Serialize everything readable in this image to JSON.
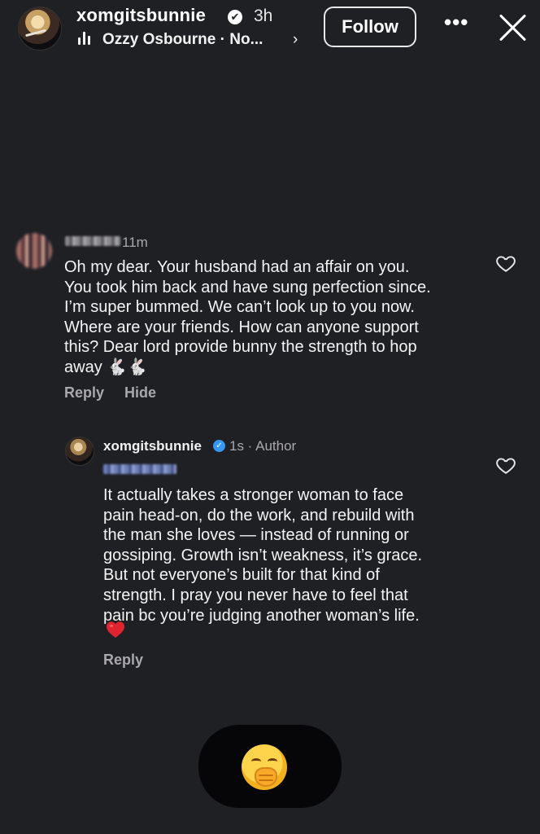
{
  "header": {
    "username": "xomgitsbunnie",
    "verified_glyph": "✔",
    "time": "3h",
    "music": "Ozzy Osbourne · No...",
    "music_icon": "music-bars-icon",
    "chevron": "›",
    "follow_label": "Follow",
    "more_label": "•••"
  },
  "comments": [
    {
      "time": "11m",
      "text": "Oh my dear. Your husband had an affair on you.\nYou took him back and have sung perfection since.\nI’m super bummed. We can’t look up to you now.\nWhere are your friends. How can anyone support\nthis? Dear lord provide bunny the strength to hop\naway 🐇🐇",
      "reply_label": "Reply",
      "hide_label": "Hide"
    },
    {
      "username": "xomgitsbunnie",
      "verified_glyph": "✓",
      "time": "1s · Author",
      "text": "It actually takes a stronger woman to face\npain head-on, do the work, and rebuild with\nthe man she loves — instead of running or\ngossiping. Growth isn’t weakness, it’s grace.\nBut not everyone’s built for that kind of\nstrength. I pray you never have to feel that\npain bc you’re judging another woman’s life.",
      "reply_label": "Reply"
    }
  ],
  "reaction": {
    "emoji": "face-with-hand-over-mouth"
  },
  "colors": {
    "background": "#1f2024",
    "muted_text": "#a8a8ad",
    "verified_blue": "#3897f0",
    "heart_red": "#e0242f"
  }
}
